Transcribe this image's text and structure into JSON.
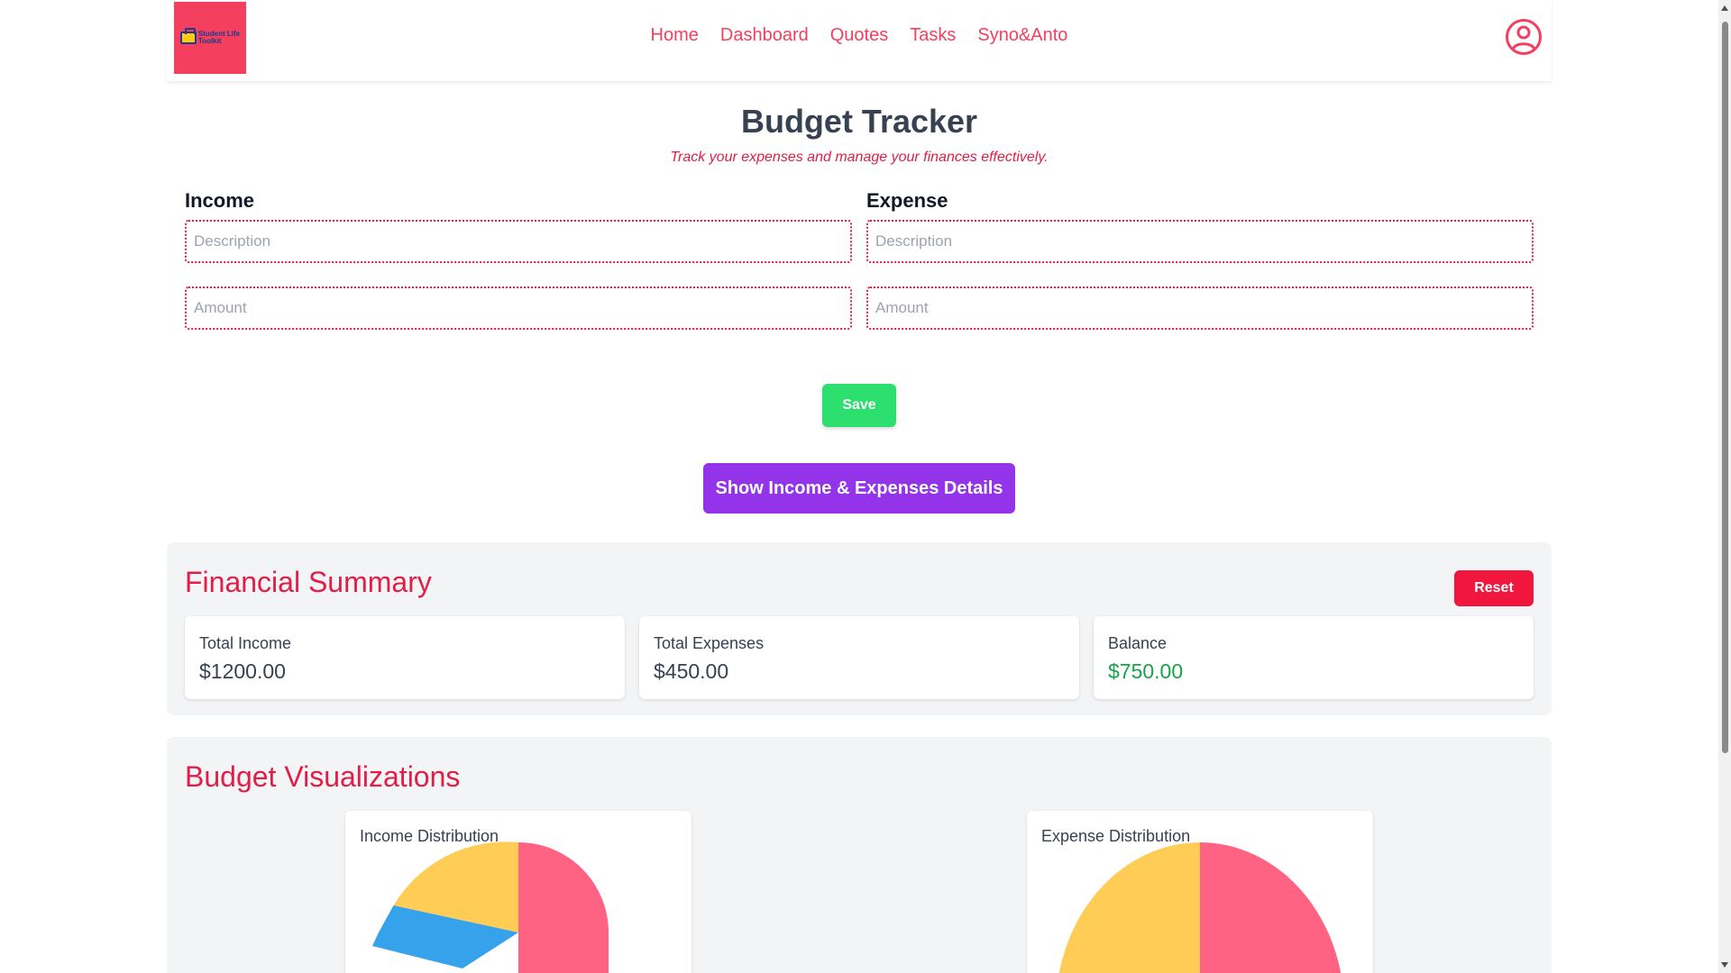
{
  "nav": {
    "logo_text_line1": "Student Life",
    "logo_text_line2": "Toolkit",
    "links": [
      "Home",
      "Dashboard",
      "Quotes",
      "Tasks",
      "Syno&Anto"
    ],
    "profile_icon": "user-circle-icon"
  },
  "header": {
    "title": "Budget Tracker",
    "subtitle": "Track your expenses and manage your finances effectively."
  },
  "income": {
    "heading": "Income",
    "description_placeholder": "Description",
    "amount_placeholder": "Amount"
  },
  "expense": {
    "heading": "Expense",
    "description_placeholder": "Description",
    "amount_placeholder": "Amount"
  },
  "buttons": {
    "save": "Save",
    "show_details": "Show Income & Expenses Details",
    "reset": "Reset"
  },
  "summary": {
    "title": "Financial Summary",
    "total_income_label": "Total Income",
    "total_income_value": "$1200.00",
    "total_expenses_label": "Total Expenses",
    "total_expenses_value": "$450.00",
    "balance_label": "Balance",
    "balance_value": "$750.00"
  },
  "visualizations": {
    "title": "Budget Visualizations",
    "income_chart_title": "Income Distribution",
    "expense_chart_title": "Expense Distribution"
  },
  "colors": {
    "accent": "#e11d48",
    "save": "#2ddf6e",
    "show_details": "#9333ea",
    "reset": "#f0163e",
    "balance": "#16a34a",
    "pie_pink": "#ff6384",
    "pie_yellow": "#ffcd56",
    "pie_blue": "#36a2eb"
  }
}
